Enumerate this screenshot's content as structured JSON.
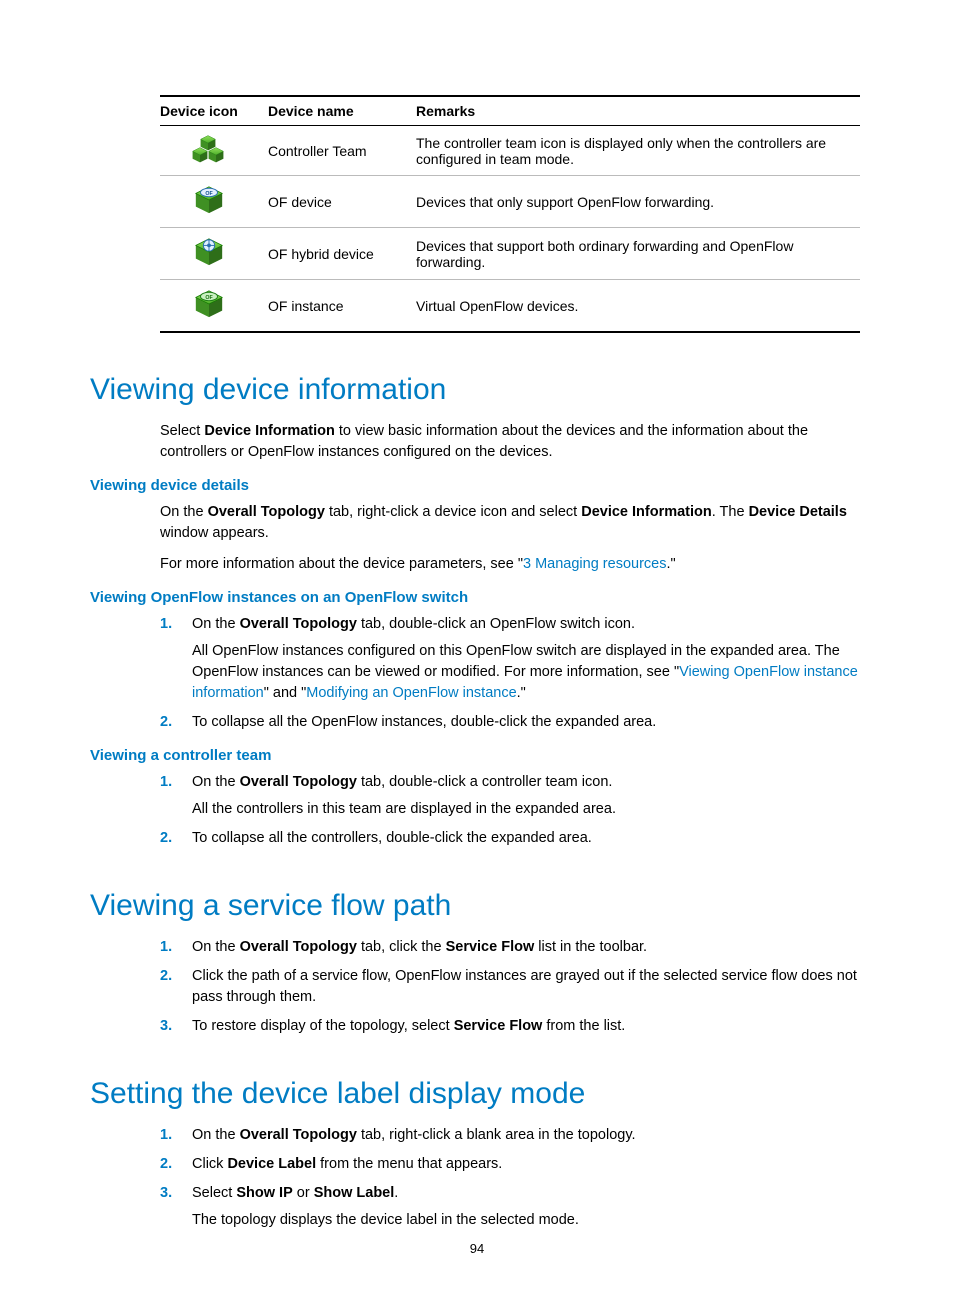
{
  "table": {
    "headers": {
      "icon": "Device icon",
      "name": "Device name",
      "remarks": "Remarks"
    },
    "rows": [
      {
        "name": "Controller Team",
        "remarks": "The controller team icon is displayed only when the controllers are configured in team mode."
      },
      {
        "name": "OF device",
        "remarks": "Devices that only support OpenFlow forwarding."
      },
      {
        "name": "OF hybrid device",
        "remarks": "Devices that support both ordinary forwarding and OpenFlow forwarding."
      },
      {
        "name": "OF instance",
        "remarks": "Virtual OpenFlow devices."
      }
    ]
  },
  "s1": {
    "title": "Viewing device information",
    "intro_a": "Select ",
    "intro_b": "Device Information",
    "intro_c": " to view basic information about the devices and the information about the controllers or OpenFlow instances configured on the devices.",
    "details": {
      "title": "Viewing device details",
      "p1_a": "On the ",
      "p1_b": "Overall Topology",
      "p1_c": " tab, right-click a device icon and select ",
      "p1_d": "Device Information",
      "p1_e": ". The ",
      "p1_f": "Device Details",
      "p1_g": " window appears.",
      "p2_a": "For more information about the device parameters, see \"",
      "p2_link": "3 Managing resources",
      "p2_c": ".\""
    },
    "ofi": {
      "title": "Viewing OpenFlow instances on an OpenFlow switch",
      "s1_a": "On the ",
      "s1_b": "Overall Topology",
      "s1_c": " tab, double-click an OpenFlow switch icon.",
      "s1_p_a": "All OpenFlow instances configured on this OpenFlow switch are displayed in the expanded area. The OpenFlow instances can be viewed or modified. For more information, see \"",
      "s1_p_link1": "Viewing OpenFlow instance information",
      "s1_p_mid": "\" and \"",
      "s1_p_link2": "Modifying an OpenFlow instance",
      "s1_p_end": ".\"",
      "s2": "To collapse all the OpenFlow instances, double-click the expanded area."
    },
    "team": {
      "title": "Viewing a controller team",
      "s1_a": "On the ",
      "s1_b": "Overall Topology",
      "s1_c": " tab, double-click a controller team icon.",
      "s1_p": "All the controllers in this team are displayed in the expanded area.",
      "s2": "To collapse all the controllers, double-click the expanded area."
    }
  },
  "s2": {
    "title": "Viewing a service flow path",
    "s1_a": "On the ",
    "s1_b": "Overall Topology",
    "s1_c": " tab, click the ",
    "s1_d": "Service Flow",
    "s1_e": " list in the toolbar.",
    "s2": "Click the path of a service flow, OpenFlow instances are grayed out if the selected service flow does not pass through them.",
    "s3_a": "To restore display of the topology, select ",
    "s3_b": "Service Flow",
    "s3_c": " from the list."
  },
  "s3": {
    "title": "Setting the device label display mode",
    "s1_a": "On the ",
    "s1_b": "Overall Topology",
    "s1_c": " tab, right-click a blank area in the topology.",
    "s2_a": "Click ",
    "s2_b": "Device Label",
    "s2_c": " from the menu that appears.",
    "s3_a": "Select ",
    "s3_b": "Show IP",
    "s3_c": " or ",
    "s3_d": "Show Label",
    "s3_e": ".",
    "s3_p": "The topology displays the device label in the selected mode."
  },
  "num": {
    "n1": "1.",
    "n2": "2.",
    "n3": "3."
  },
  "page_no": "94"
}
